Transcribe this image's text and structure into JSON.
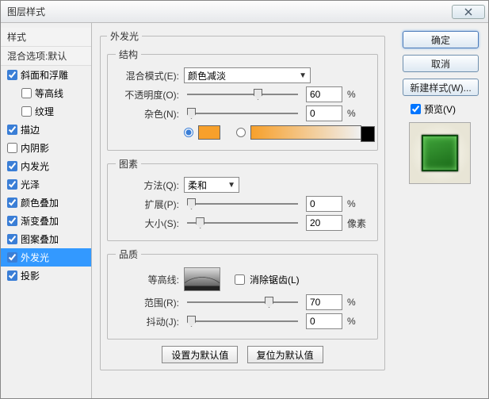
{
  "title": "图层样式",
  "sidebar": {
    "header": "样式",
    "blend": "混合选项:默认",
    "items": [
      {
        "label": "斜面和浮雕",
        "checked": true
      },
      {
        "label": "等高线",
        "checked": false,
        "indent": true
      },
      {
        "label": "纹理",
        "checked": false,
        "indent": true
      },
      {
        "label": "描边",
        "checked": true
      },
      {
        "label": "内阴影",
        "checked": false
      },
      {
        "label": "内发光",
        "checked": true
      },
      {
        "label": "光泽",
        "checked": true
      },
      {
        "label": "颜色叠加",
        "checked": true
      },
      {
        "label": "渐变叠加",
        "checked": true
      },
      {
        "label": "图案叠加",
        "checked": true
      },
      {
        "label": "外发光",
        "checked": true,
        "selected": true
      },
      {
        "label": "投影",
        "checked": true
      }
    ]
  },
  "panel_title": "外发光",
  "structure": {
    "legend": "结构",
    "blend_mode_label": "混合模式(E):",
    "blend_mode_value": "颜色减淡",
    "opacity_label": "不透明度(O):",
    "opacity_value": "60",
    "opacity_unit": "%",
    "noise_label": "杂色(N):",
    "noise_value": "0",
    "noise_unit": "%",
    "swatch_color": "#f7a02b"
  },
  "elements": {
    "legend": "图素",
    "method_label": "方法(Q):",
    "method_value": "柔和",
    "spread_label": "扩展(P):",
    "spread_value": "0",
    "spread_unit": "%",
    "size_label": "大小(S):",
    "size_value": "20",
    "size_unit": "像素"
  },
  "quality": {
    "legend": "品质",
    "contour_label": "等高线:",
    "antialias_label": "消除锯齿(L)",
    "range_label": "范围(R):",
    "range_value": "70",
    "range_unit": "%",
    "jitter_label": "抖动(J):",
    "jitter_value": "0",
    "jitter_unit": "%"
  },
  "buttons": {
    "default": "设置为默认值",
    "reset": "复位为默认值",
    "ok": "确定",
    "cancel": "取消",
    "newstyle": "新建样式(W)...",
    "preview": "预览(V)"
  }
}
